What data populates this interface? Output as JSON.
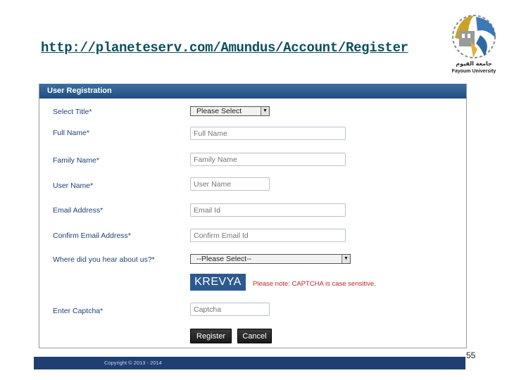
{
  "slide": {
    "url_title": "http://planeteserv.com/Amundus/Account/Register",
    "page_number": "55"
  },
  "logo": {
    "english_text": "Fayoum University",
    "arabic_text": "جامعة الفيوم"
  },
  "form": {
    "header": "User Registration",
    "title_label": "Select Title*",
    "title_value": "Please Select",
    "full_name_label": "Full Name*",
    "full_name_placeholder": "Full Name",
    "family_name_label": "Family Name*",
    "family_name_placeholder": "Family Name",
    "user_name_label": "User Name*",
    "user_name_placeholder": "User Name",
    "email_label": "Email Address*",
    "email_placeholder": "Email Id",
    "confirm_email_label": "Confirm Email Address*",
    "confirm_email_placeholder": "Confirm Email Id",
    "hear_label": "Where did you hear about us?*",
    "hear_value": "--Please Select--",
    "captcha_text": "KREVYA",
    "captcha_note": "Please note: CAPTCHA is case sensitive.",
    "enter_captcha_label": "Enter Captcha*",
    "captcha_placeholder": "Captcha",
    "register_label": "Register",
    "cancel_label": "Cancel"
  },
  "footer": {
    "copyright": "Copyright © 2013 - 2014"
  }
}
